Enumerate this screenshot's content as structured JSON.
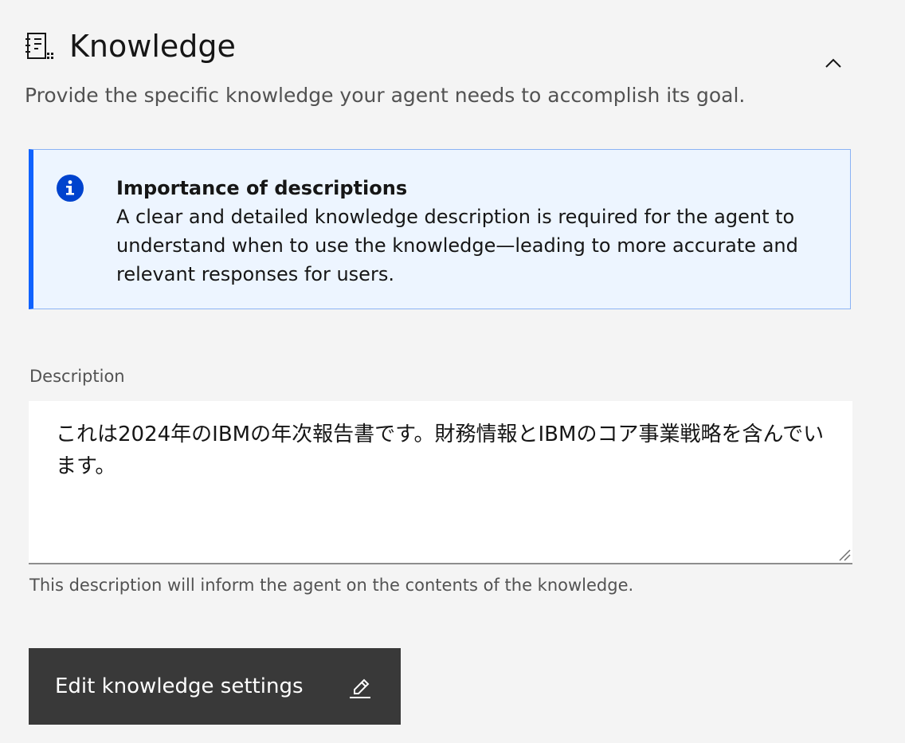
{
  "section": {
    "icon": "knowledge-icon",
    "title": "Knowledge",
    "subtitle": "Provide the specific knowledge your agent needs to accomplish its goal.",
    "collapse_icon": "chevron-up-icon"
  },
  "notification": {
    "icon": "info-icon",
    "title": "Importance of descriptions",
    "body": "A clear and detailed knowledge description is required for the agent to understand when to use the knowledge—leading to more accurate and relevant responses for users.",
    "accent_color": "#0f62fe",
    "background_color": "#edf5ff"
  },
  "description_field": {
    "label": "Description",
    "value": "これは2024年のIBMの年次報告書です。財務情報とIBMのコア事業戦略を含んでいます。",
    "helper_text": "This description will inform the agent on the contents of the knowledge."
  },
  "edit_button": {
    "label": "Edit knowledge settings",
    "icon": "pencil-icon",
    "background_color": "#393939"
  }
}
